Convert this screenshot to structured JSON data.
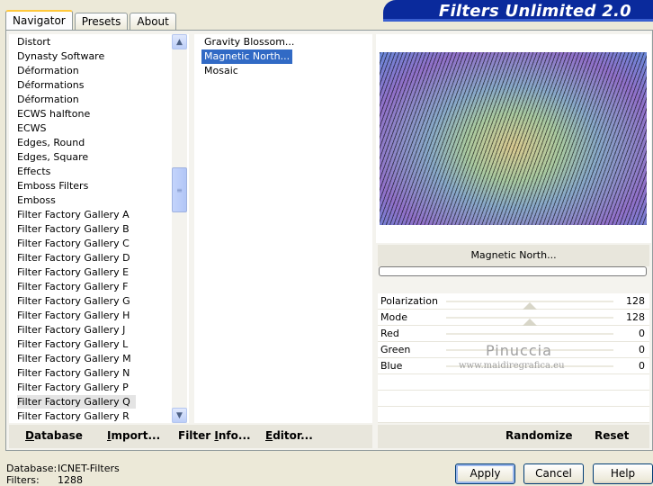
{
  "tabs": [
    {
      "label": "Navigator",
      "active": true
    },
    {
      "label": "Presets",
      "active": false
    },
    {
      "label": "About",
      "active": false
    }
  ],
  "banner": {
    "title": "Filters Unlimited 2.0"
  },
  "categories": [
    "Distort",
    "Dynasty Software",
    "Déformation",
    "Déformations",
    "Déformation",
    "ECWS halftone",
    "ECWS",
    "Edges, Round",
    "Edges, Square",
    "Effects",
    "Emboss Filters",
    "Emboss",
    "Filter Factory Gallery A",
    "Filter Factory Gallery B",
    "Filter Factory Gallery C",
    "Filter Factory Gallery D",
    "Filter Factory Gallery E",
    "Filter Factory Gallery F",
    "Filter Factory Gallery G",
    "Filter Factory Gallery H",
    "Filter Factory Gallery J",
    "Filter Factory Gallery L",
    "Filter Factory Gallery M",
    "Filter Factory Gallery N",
    "Filter Factory Gallery P",
    "Filter Factory Gallery Q",
    "Filter Factory Gallery R"
  ],
  "selected_category": "Filter Factory Gallery Q",
  "filters": [
    "Gravity Blossom...",
    "Magnetic North...",
    "Mosaic"
  ],
  "selected_filter": "Magnetic North...",
  "filter_name": "Magnetic North...",
  "progress": 0,
  "sliders": [
    {
      "label": "Polarization",
      "value": "128",
      "level": 0.5
    },
    {
      "label": "Mode",
      "value": "128",
      "level": 0.5
    },
    {
      "label": "Red",
      "value": "0",
      "level": 0
    },
    {
      "label": "Green",
      "value": "0",
      "level": 0
    },
    {
      "label": "Blue",
      "value": "0",
      "level": 0
    }
  ],
  "watermark": {
    "name": "Pinuccia",
    "url": "www.maidiregrafica.eu"
  },
  "left_toolbar": {
    "database": {
      "first": "D",
      "rest": "atabase"
    },
    "import": {
      "first": "I",
      "rest": "mport..."
    },
    "filter_info": {
      "pre": "Filter ",
      "first": "I",
      "rest": "nfo..."
    },
    "editor": {
      "first": "E",
      "rest": "ditor..."
    }
  },
  "right_toolbar": {
    "randomize": "Randomize",
    "reset": "Reset"
  },
  "status": {
    "database_label": "Database:",
    "database_value": "ICNET-Filters",
    "filters_label": "Filters:",
    "filters_value": "1288"
  },
  "buttons": {
    "apply": "Apply",
    "cancel": "Cancel",
    "help": "Help"
  },
  "icons": {
    "scroll_up": "scroll-up-arrow-icon",
    "scroll_down": "scroll-down-arrow-icon"
  }
}
